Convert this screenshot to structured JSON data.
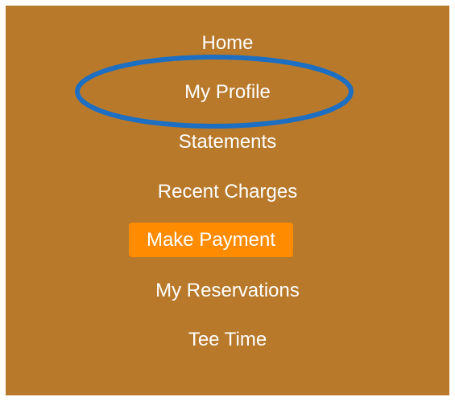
{
  "nav": {
    "items": [
      {
        "label": "Home"
      },
      {
        "label": "My Profile"
      },
      {
        "label": "Statements"
      },
      {
        "label": "Recent Charges"
      },
      {
        "label": "Make Payment",
        "active": true
      },
      {
        "label": "My Reservations"
      },
      {
        "label": "Tee Time"
      }
    ]
  },
  "colors": {
    "panel_background": "#b8792b",
    "active_button": "#ff8c00",
    "annotation_ring": "#1c6fc2",
    "text": "#ffffff"
  }
}
